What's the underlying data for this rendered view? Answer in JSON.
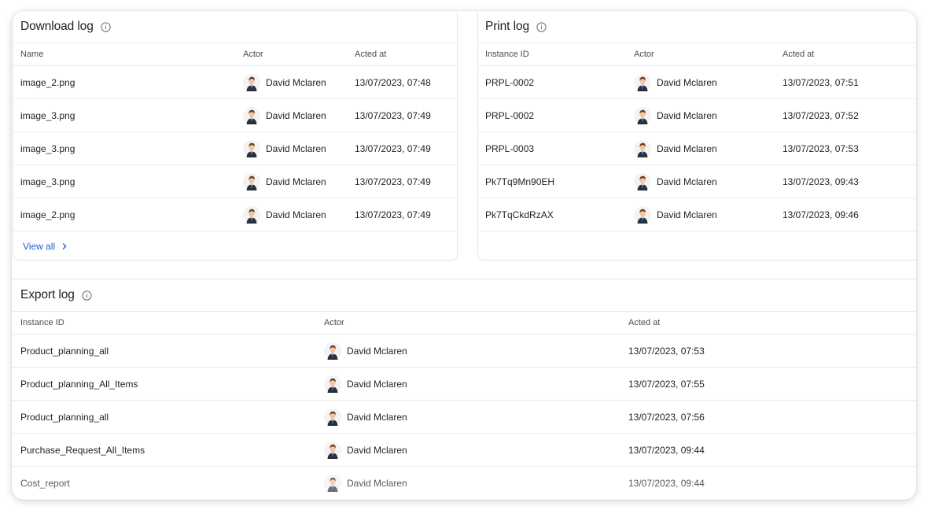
{
  "download_log": {
    "title": "Download log",
    "columns": [
      "Name",
      "Actor",
      "Acted at"
    ],
    "rows": [
      {
        "name": "image_2.png",
        "actor": "David Mclaren",
        "acted_at": "13/07/2023, 07:48"
      },
      {
        "name": "image_3.png",
        "actor": "David Mclaren",
        "acted_at": "13/07/2023, 07:49"
      },
      {
        "name": "image_3.png",
        "actor": "David Mclaren",
        "acted_at": "13/07/2023, 07:49"
      },
      {
        "name": "image_3.png",
        "actor": "David Mclaren",
        "acted_at": "13/07/2023, 07:49"
      },
      {
        "name": "image_2.png",
        "actor": "David Mclaren",
        "acted_at": "13/07/2023, 07:49"
      }
    ],
    "view_all_label": "View all"
  },
  "print_log": {
    "title": "Print log",
    "columns": [
      "Instance ID",
      "Actor",
      "Acted at"
    ],
    "rows": [
      {
        "name": "PRPL-0002",
        "actor": "David Mclaren",
        "acted_at": "13/07/2023, 07:51"
      },
      {
        "name": "PRPL-0002",
        "actor": "David Mclaren",
        "acted_at": "13/07/2023, 07:52"
      },
      {
        "name": "PRPL-0003",
        "actor": "David Mclaren",
        "acted_at": "13/07/2023, 07:53"
      },
      {
        "name": "Pk7Tq9Mn90EH",
        "actor": "David Mclaren",
        "acted_at": "13/07/2023, 09:43"
      },
      {
        "name": "Pk7TqCkdRzAX",
        "actor": "David Mclaren",
        "acted_at": "13/07/2023, 09:46"
      }
    ]
  },
  "export_log": {
    "title": "Export log",
    "columns": [
      "Instance ID",
      "Actor",
      "Acted at"
    ],
    "rows": [
      {
        "name": "Product_planning_all",
        "actor": "David Mclaren",
        "acted_at": "13/07/2023, 07:53"
      },
      {
        "name": "Product_planning_All_Items",
        "actor": "David Mclaren",
        "acted_at": "13/07/2023, 07:55"
      },
      {
        "name": "Product_planning_all",
        "actor": "David Mclaren",
        "acted_at": "13/07/2023, 07:56"
      },
      {
        "name": "Purchase_Request_All_Items",
        "actor": "David Mclaren",
        "acted_at": "13/07/2023, 09:44"
      },
      {
        "name": "Cost_report",
        "actor": "David Mclaren",
        "acted_at": "13/07/2023, 09:44"
      }
    ]
  },
  "icons": {
    "info": "info-icon",
    "avatar": "avatar",
    "chevron": "chevron-right-icon"
  },
  "colors": {
    "link": "#1a5fd6",
    "border": "#e6e6ea",
    "text": "#1f1f23"
  }
}
